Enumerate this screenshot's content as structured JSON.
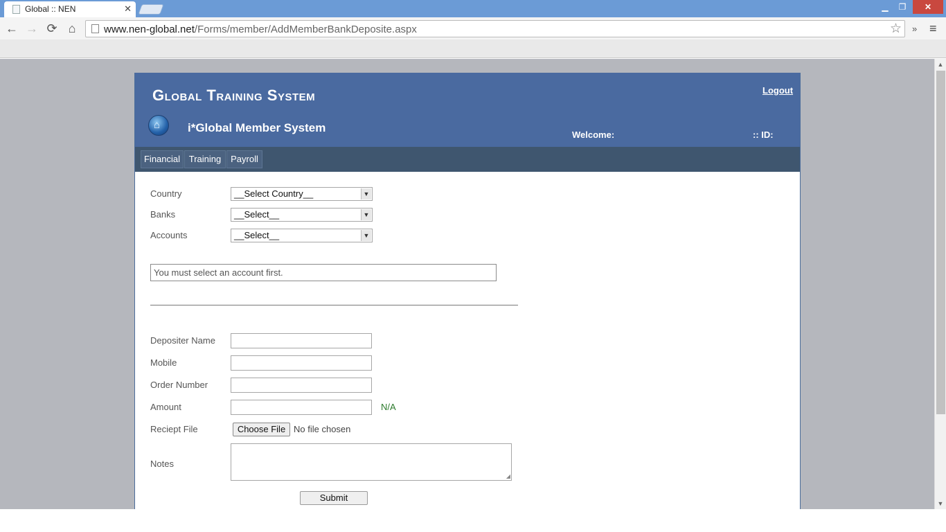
{
  "browser": {
    "tab_title": "Global :: NEN",
    "tab_close": "✕",
    "url_host": "www.nen-global.net",
    "url_path": "/Forms/member/AddMemberBankDeposite.aspx",
    "minimize": "▁",
    "maximize": "❐",
    "close": "✕",
    "back": "←",
    "forward": "→",
    "reload": "⟳",
    "home": "⌂",
    "bookmark_star": "☆",
    "extensions": "»",
    "menu": "≡"
  },
  "header": {
    "title": "Global Training System",
    "logout": "Logout",
    "system_name": "i*Global Member System",
    "welcome": "Welcome:",
    "id_label": ":: ID:",
    "home_glyph": "⌂"
  },
  "nav": {
    "items": [
      "Financial",
      "Training",
      "Payroll"
    ]
  },
  "form": {
    "country_label": "Country",
    "country_value": "__Select Country__",
    "banks_label": "Banks",
    "banks_value": "__Select__",
    "accounts_label": "Accounts",
    "accounts_value": "__Select__",
    "message": "You must select an account first.",
    "depositer_label": "Depositer Name",
    "mobile_label": "Mobile",
    "order_label": "Order Number",
    "amount_label": "Amount",
    "amount_note": "N/A",
    "receipt_label": "Reciept File",
    "choose_file": "Choose File",
    "no_file": "No file chosen",
    "notes_label": "Notes",
    "submit": "Submit"
  }
}
